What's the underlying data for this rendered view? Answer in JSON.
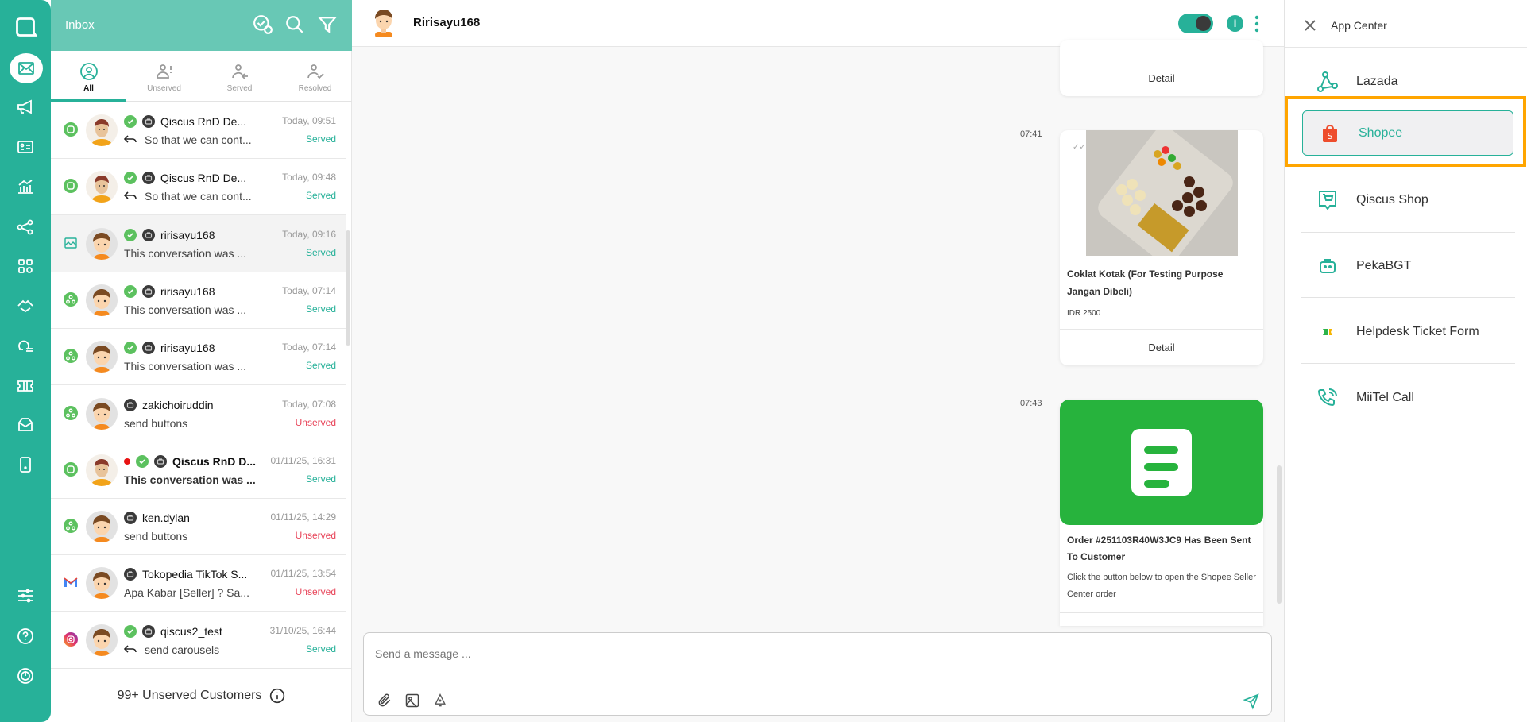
{
  "nav": {
    "items": [
      "logo",
      "inbox",
      "broadcast",
      "contacts",
      "analytics",
      "integrations",
      "apps",
      "handover",
      "agents",
      "tickets",
      "archive",
      "mobile"
    ],
    "bottom": [
      "settings",
      "help",
      "logout"
    ],
    "accent": "#27b199"
  },
  "inbox": {
    "title": "Inbox",
    "tabs": [
      {
        "label": "All"
      },
      {
        "label": "Unserved"
      },
      {
        "label": "Served"
      },
      {
        "label": "Resolved"
      }
    ],
    "conversations": [
      {
        "channel": "qiscus",
        "avatar": "man",
        "unread": false,
        "resolved": true,
        "name": "Qiscus RnD De...",
        "time": "Today, 09:51",
        "reply": true,
        "preview": "So that we can cont...",
        "status": "Served"
      },
      {
        "channel": "qiscus",
        "avatar": "man",
        "unread": false,
        "resolved": true,
        "name": "Qiscus RnD De...",
        "time": "Today, 09:48",
        "reply": true,
        "preview": "So that we can cont...",
        "status": "Served"
      },
      {
        "channel": "widget",
        "avatar": "boy",
        "unread": false,
        "resolved": true,
        "name": "ririsayu168",
        "time": "Today, 09:16",
        "reply": false,
        "preview": "This conversation was ...",
        "status": "Served",
        "selected": true
      },
      {
        "channel": "custom",
        "avatar": "boy",
        "unread": false,
        "resolved": true,
        "name": "ririsayu168",
        "time": "Today, 07:14",
        "reply": false,
        "preview": "This conversation was ...",
        "status": "Served"
      },
      {
        "channel": "custom",
        "avatar": "boy",
        "unread": false,
        "resolved": true,
        "name": "ririsayu168",
        "time": "Today, 07:14",
        "reply": false,
        "preview": "This conversation was ...",
        "status": "Served"
      },
      {
        "channel": "custom",
        "avatar": "boy",
        "unread": false,
        "resolved": false,
        "name": "zakichoiruddin",
        "time": "Today, 07:08",
        "reply": false,
        "preview": "send buttons",
        "status": "Unserved"
      },
      {
        "channel": "qiscus",
        "avatar": "man",
        "unread": true,
        "resolved": true,
        "name": "Qiscus RnD D...",
        "time": "01/11/25, 16:31",
        "reply": false,
        "preview": "This conversation was ...",
        "status": "Served",
        "bold": true
      },
      {
        "channel": "custom",
        "avatar": "boy",
        "unread": false,
        "resolved": false,
        "name": "ken.dylan",
        "time": "01/11/25, 14:29",
        "reply": false,
        "preview": "send buttons",
        "status": "Unserved"
      },
      {
        "channel": "gmail",
        "avatar": "boy",
        "unread": false,
        "resolved": false,
        "name": "Tokopedia TikTok S...",
        "time": "01/11/25, 13:54",
        "reply": false,
        "preview": "Apa Kabar [Seller] ? Sa...",
        "status": "Unserved"
      },
      {
        "channel": "instagram",
        "avatar": "boy",
        "unread": false,
        "resolved": true,
        "name": "qiscus2_test",
        "time": "31/10/25, 16:44",
        "reply": true,
        "preview": "send carousels",
        "status": "Served"
      }
    ],
    "unserved_label": "99+ Unserved Customers",
    "status_colors": {
      "Served": "#27b199",
      "Unserved": "#e8455a"
    }
  },
  "chat": {
    "contact_name": "Ririsayu168",
    "messages": [
      {
        "detail_label": "Detail"
      },
      {
        "time": "07:41",
        "title": "Coklat Kotak (For Testing Purpose Jangan Dibeli)",
        "price": "IDR 2500",
        "detail_label": "Detail"
      },
      {
        "time": "07:43",
        "title": "Order #251103R40W3JC9 Has Been Sent To Customer",
        "body": "Click the button below to open the Shopee Seller Center order"
      }
    ],
    "input_placeholder": "Send a message ..."
  },
  "app_center": {
    "title": "App Center",
    "items": [
      {
        "label": "Lazada"
      },
      {
        "label": "Shopee",
        "selected": true
      },
      {
        "label": "Qiscus Shop"
      },
      {
        "label": "PekaBGT"
      },
      {
        "label": "Helpdesk Ticket Form"
      },
      {
        "label": "MiiTel Call"
      }
    ],
    "highlight_color": "#ffa500"
  }
}
